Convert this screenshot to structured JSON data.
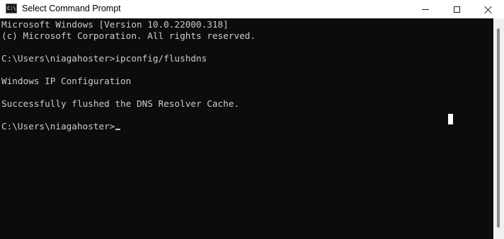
{
  "window": {
    "title": "Select Command Prompt",
    "icon_text": "C:\\"
  },
  "icons": {
    "app": "command-prompt-icon",
    "minimize": "minimize-icon",
    "maximize": "maximize-icon",
    "close": "close-icon"
  },
  "console": {
    "lines": [
      "Microsoft Windows [Version 10.0.22000.318]",
      "(c) Microsoft Corporation. All rights reserved.",
      "C:\\Users\\niagahoster>ipconfig/flushdns",
      "Windows IP Configuration",
      "Successfully flushed the DNS Resolver Cache.",
      "C:\\Users\\niagahoster>"
    ]
  },
  "colors": {
    "console_background": "#0c0c0c",
    "console_text": "#cccccc",
    "titlebar": "#ffffff"
  }
}
